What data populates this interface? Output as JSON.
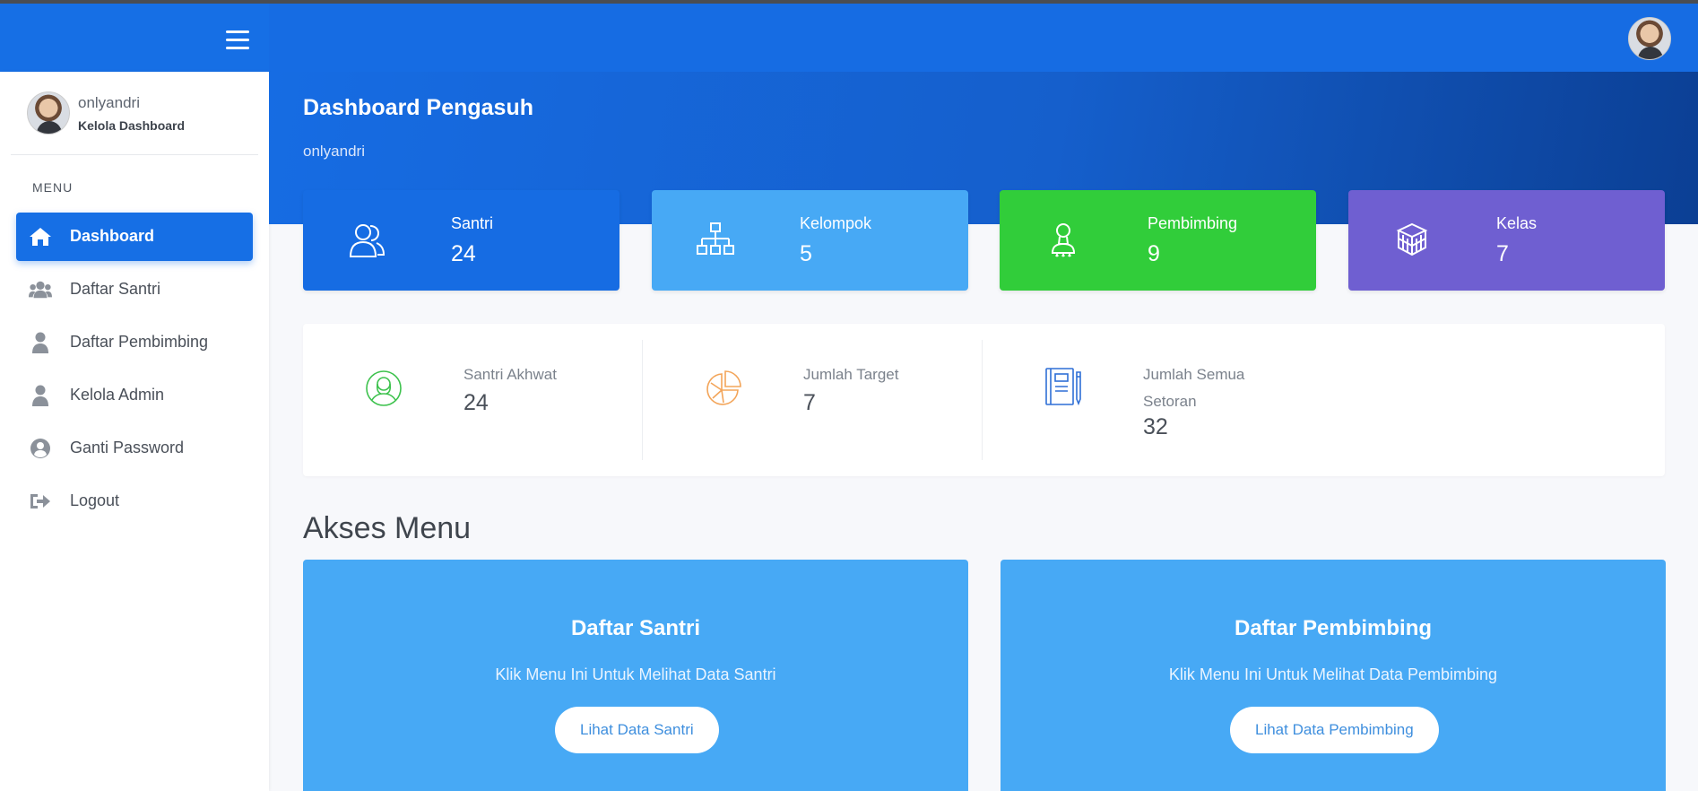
{
  "app": {
    "accent_color": "#166fe5",
    "menu_icon": "hamburger-menu-icon"
  },
  "user": {
    "name": "onlyandri",
    "role": "Kelola Dashboard"
  },
  "sidebar": {
    "heading": "MENU",
    "items": [
      {
        "label": "Dashboard",
        "icon": "home-icon",
        "active": true
      },
      {
        "label": "Daftar Santri",
        "icon": "users-icon",
        "active": false
      },
      {
        "label": "Daftar Pembimbing",
        "icon": "user-icon",
        "active": false
      },
      {
        "label": "Kelola Admin",
        "icon": "user-icon",
        "active": false
      },
      {
        "label": "Ganti Password",
        "icon": "user-circle-icon",
        "active": false
      },
      {
        "label": "Logout",
        "icon": "sign-out-icon",
        "active": false
      }
    ]
  },
  "page": {
    "title": "Dashboard Pengasuh",
    "subtitle": "onlyandri"
  },
  "stats": [
    {
      "label": "Santri",
      "value": "24",
      "color": "#166ce3",
      "icon": "users-outline-icon"
    },
    {
      "label": "Kelompok",
      "value": "5",
      "color": "#47a9f5",
      "icon": "hierarchy-icon"
    },
    {
      "label": "Pembimbing",
      "value": "9",
      "color": "#31cd3a",
      "icon": "mentor-icon"
    },
    {
      "label": "Kelas",
      "value": "7",
      "color": "#6f5fd1",
      "icon": "boxes-icon"
    }
  ],
  "info": [
    {
      "label": "Santri Akhwat",
      "value": "24",
      "color": "#3ec24e",
      "icon": "female-user-icon"
    },
    {
      "label": "Jumlah Target",
      "value": "7",
      "color": "#f3a55a",
      "icon": "pie-chart-icon"
    },
    {
      "label": "Jumlah Semua Setoran",
      "label_line1": "Jumlah Semua",
      "label_line2": "Setoran",
      "value": "32",
      "color": "#2f6fd6",
      "icon": "notebook-pen-icon"
    }
  ],
  "access": {
    "heading": "Akses Menu",
    "cards": [
      {
        "title": "Daftar Santri",
        "description": "Klik Menu Ini Untuk Melihat Data Santri",
        "button": "Lihat Data Santri"
      },
      {
        "title": "Daftar Pembimbing",
        "description": "Klik Menu Ini Untuk Melihat Data Pembimbing",
        "button": "Lihat Data Pembimbing"
      }
    ]
  }
}
